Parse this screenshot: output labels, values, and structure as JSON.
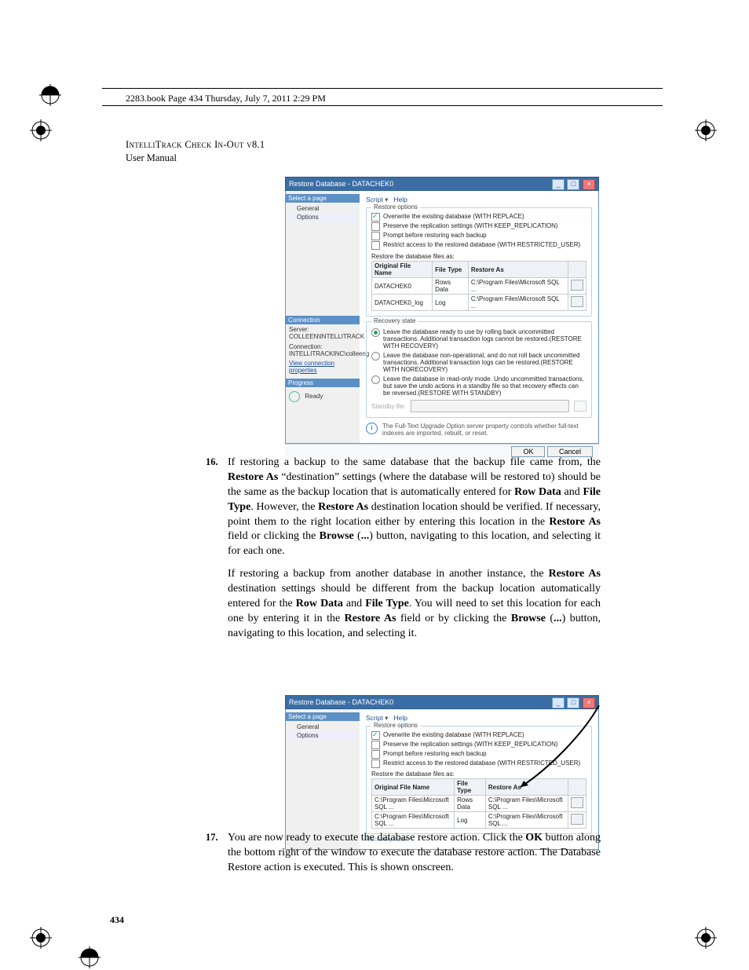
{
  "page_header": "2283.book  Page 434  Thursday, July 7, 2011  2:29 PM",
  "running_head_line1": "IntelliTrack Check In-Out v8.1",
  "running_head_line2": "User Manual",
  "page_number": "434",
  "step16": {
    "num": "16.",
    "para1_before": "If restoring a backup to the same database that the backup file came from, the ",
    "b1": "Restore As",
    "para1_mid1": " “destination” settings (where the database will be restored to) should be the same as the backup location that is automatically entered for ",
    "b2": "Row Data",
    "and1": " and ",
    "b3": "File Type",
    "para1_mid2": ". However, the ",
    "b4": "Restore As",
    "para1_mid3": " destination location should be verified. If necessary, point them to the right location either by entering this location in the ",
    "b5": "Restore As",
    "para1_mid4": " field or clicking the ",
    "b6": "Browse",
    "para1_mid5": " (",
    "b7": "...",
    "para1_end": ") button, navigating to this location, and selecting it for each one.",
    "para2_before": "If restoring a backup from another database in another instance, the ",
    "b8": "Restore As",
    "para2_mid1": " destination settings should be different from the backup location automatically entered for the ",
    "b9": "Row Data",
    "and2": " and ",
    "b10": "File Type",
    "para2_mid2": ". You will need to set this location for each one by entering it in the ",
    "b11": "Restore As",
    "para2_mid3": " field or by clicking the ",
    "b12": "Browse",
    "para2_mid4": " (",
    "b13": "...",
    "para2_end": ") button, navigating to this location, and selecting it."
  },
  "step17": {
    "num": "17.",
    "before": "You are now ready to execute the database restore action. Click the ",
    "b1": "OK",
    "after": " button along the bottom right of the window to execute the database restore action. The Database Restore action is executed. This is shown onscreen."
  },
  "dialog1": {
    "title": "Restore Database - DATACHEK0",
    "left": {
      "panehead1": "Select a page",
      "items": [
        "General",
        "Options"
      ],
      "panehead2": "Connection",
      "server_label": "Server:",
      "server_value": "COLLEEN\\INTELLITRACK",
      "conn_label": "Connection:",
      "conn_value": "INTELLITRACKINC\\colleeng",
      "view_conn": "View connection properties",
      "panehead3": "Progress",
      "ready": "Ready"
    },
    "toolbar": {
      "script": "Script",
      "help": "Help"
    },
    "restore_options_legend": "Restore options",
    "chk": {
      "overwrite": "Overwrite the existing database (WITH REPLACE)",
      "preserve": "Preserve the replication settings (WITH KEEP_REPLICATION)",
      "prompt": "Prompt before restoring each backup",
      "restrict": "Restrict access to the restored database (WITH RESTRICTED_USER)"
    },
    "files_label": "Restore the database files as:",
    "table": {
      "h1": "Original File Name",
      "h2": "File Type",
      "h3": "Restore As",
      "rows": [
        {
          "c1": "DATACHEK0",
          "c2": "Rows Data",
          "c3": "C:\\Program Files\\Microsoft SQL ..."
        },
        {
          "c1": "DATACHEK0_log",
          "c2": "Log",
          "c3": "C:\\Program Files\\Microsoft SQL ..."
        }
      ]
    },
    "recovery_legend": "Recovery state",
    "radios": {
      "r1": "Leave the database ready to use by rolling back uncommitted transactions. Additional transaction logs cannot be restored.(RESTORE WITH RECOVERY)",
      "r2": "Leave the database non-operational, and do not roll back uncommitted transactions. Additional transaction logs can be restored.(RESTORE WITH NORECOVERY)",
      "r3": "Leave the database in read-only mode. Undo uncommitted transactions, but save the undo actions in a standby file so that recovery effects can be reversed.(RESTORE WITH STANDBY)"
    },
    "standby_label": "Standby file:",
    "info": "The Full-Text Upgrade Option server property controls whether full-text indexes are imported, rebuilt, or reset.",
    "ok": "OK",
    "cancel": "Cancel"
  },
  "dialog2": {
    "title": "Restore Database - DATACHEK0",
    "table": {
      "rows": [
        {
          "c1": "C:\\Program Files\\Microsoft SQL ...",
          "c2": "Rows Data",
          "c3": "C:\\Program Files\\Microsoft SQL ..."
        },
        {
          "c1": "C:\\Program Files\\Microsoft SQL ...",
          "c2": "Log",
          "c3": "C:\\Program Files\\Microsoft SQL ..."
        }
      ]
    },
    "recovery_legend": "Recovery state"
  }
}
